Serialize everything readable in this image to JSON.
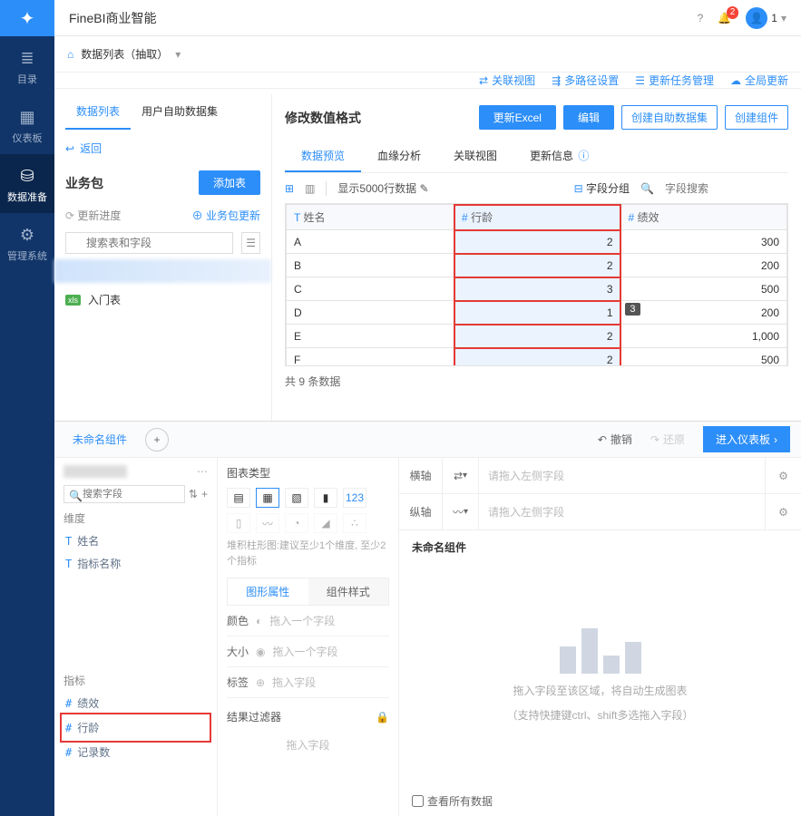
{
  "app_title": "FineBI商业智能",
  "notification_count": "2",
  "user_label": "1",
  "vnav": {
    "catalog": "目录",
    "dashboard": "仪表板",
    "data_prep": "数据准备",
    "system": "管理系统"
  },
  "breadcrumb": {
    "label": "数据列表（抽取）"
  },
  "header_links": {
    "relation": "关联视图",
    "multipath": "多路径设置",
    "task_mgmt": "更新任务管理",
    "global_update": "全局更新"
  },
  "left_tabs": {
    "list": "数据列表",
    "self": "用户自助数据集"
  },
  "back": "返回",
  "pkg_title": "业务包",
  "add_table": "添加表",
  "refresh_progress": "更新进度",
  "pkg_update": "业务包更新",
  "search_placeholder": "搜索表和字段",
  "xls_name": "入门表",
  "format_title": "修改数值格式",
  "actions": {
    "update_excel": "更新Excel",
    "edit": "编辑",
    "create_self": "创建自助数据集",
    "create_comp": "创建组件"
  },
  "ur_tabs": {
    "preview": "数据预览",
    "lineage": "血缘分析",
    "relation": "关联视图",
    "update_info": "更新信息"
  },
  "toolbar": {
    "rows_label": "显示5000行数据",
    "group": "字段分组",
    "search_ph": "字段搜索"
  },
  "columns": {
    "name": "姓名",
    "rank": "行龄",
    "perf": "绩效"
  },
  "rows": [
    {
      "name": "A",
      "rank": "2",
      "perf": "300"
    },
    {
      "name": "B",
      "rank": "2",
      "perf": "200"
    },
    {
      "name": "C",
      "rank": "3",
      "perf": "500"
    },
    {
      "name": "D",
      "rank": "1",
      "perf": "200",
      "tip": "3"
    },
    {
      "name": "E",
      "rank": "2",
      "perf": "1,000"
    },
    {
      "name": "F",
      "rank": "2",
      "perf": "500"
    }
  ],
  "footer_count": "共 9 条数据",
  "comp_tab": "未命名组件",
  "undo": "撤销",
  "redo": "还原",
  "enter_dash": "进入仪表板",
  "fields": {
    "search_ph": "搜索字段",
    "dim_title": "维度",
    "dim_name": "姓名",
    "dim_metric_name": "指标名称",
    "metric_title": "指标",
    "m_perf": "绩效",
    "m_rank": "行龄",
    "m_count": "记录数"
  },
  "chart_panel": {
    "title": "图表类型",
    "hint": "堆积柱形图:建议至少1个维度, 至少2个指标",
    "tab_graphic": "图形属性",
    "tab_style": "组件样式",
    "color": "颜色",
    "size": "大小",
    "label": "标签",
    "ph_one": "拖入一个字段",
    "ph_field": "拖入字段",
    "filter_title": "结果过滤器",
    "filter_ph": "拖入字段"
  },
  "canvas": {
    "h_axis": "横轴",
    "v_axis": "纵轴",
    "drop_ph": "请拖入左侧字段",
    "comp_name": "未命名组件",
    "hint1": "拖入字段至该区域，将自动生成图表",
    "hint2": "（支持快捷键ctrl、shift多选拖入字段）",
    "view_all": "查看所有数据"
  }
}
